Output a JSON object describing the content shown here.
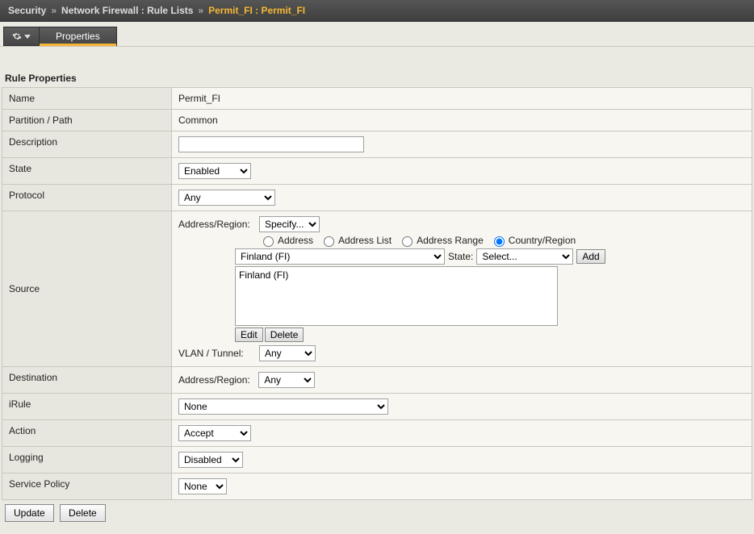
{
  "breadcrumb": {
    "root": "Security",
    "mid": "Network Firewall : Rule Lists",
    "leaf": "Permit_FI : Permit_FI"
  },
  "tabs": {
    "properties": "Properties"
  },
  "section": {
    "title": "Rule Properties"
  },
  "labels": {
    "name": "Name",
    "partition": "Partition / Path",
    "description": "Description",
    "state": "State",
    "protocol": "Protocol",
    "source": "Source",
    "destination": "Destination",
    "irule": "iRule",
    "action": "Action",
    "logging": "Logging",
    "service_policy": "Service Policy",
    "address_region": "Address/Region:",
    "vlan_tunnel": "VLAN / Tunnel:",
    "state_label": "State:"
  },
  "values": {
    "name": "Permit_FI",
    "partition": "Common",
    "description": "",
    "state_sel": "Enabled",
    "protocol_sel": "Any",
    "src_addr_region": "Specify...",
    "src_country_sel": "Finland (FI)",
    "src_state_sel": "Select...",
    "src_list_item": "Finland (FI)",
    "vlan_sel": "Any",
    "dest_addr_region": "Any",
    "irule_sel": "None",
    "action_sel": "Accept",
    "logging_sel": "Disabled",
    "service_policy_sel": "None"
  },
  "radios": {
    "address": "Address",
    "address_list": "Address List",
    "address_range": "Address Range",
    "country_region": "Country/Region"
  },
  "buttons": {
    "add": "Add",
    "edit": "Edit",
    "delete": "Delete",
    "update": "Update",
    "footer_delete": "Delete"
  }
}
